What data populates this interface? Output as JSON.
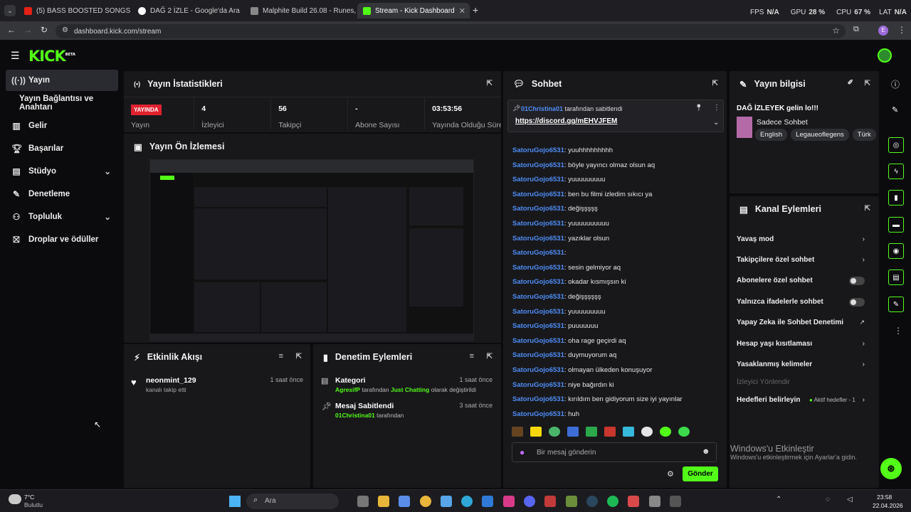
{
  "browser": {
    "tabs": [
      {
        "label": "(5) BASS BOOSTED SONGS 202"
      },
      {
        "label": "DAĞ 2 İZLE - Google'da Ara"
      },
      {
        "label": "Malphite Build 26.08 - Runes, It"
      },
      {
        "label": "Stream - Kick Dashboard"
      }
    ],
    "url": "dashboard.kick.com/stream",
    "perf": {
      "fps_label": "FPS",
      "fps_value": "N/A",
      "gpu_label": "GPU",
      "gpu_value": "28 %",
      "cpu_label": "CPU",
      "cpu_value": "67 %",
      "lat_label": "LAT",
      "lat_value": "N/A"
    },
    "profile_initial": "E"
  },
  "logo": {
    "text": "KICK",
    "beta": "BETA"
  },
  "sidebar": {
    "items": [
      {
        "label": "Yayın",
        "icon": "broadcast-icon"
      },
      {
        "label": "Yayın Bağlantısı ve Anahtarı"
      },
      {
        "label": "Gelir",
        "icon": "chart-icon"
      },
      {
        "label": "Başarılar",
        "icon": "trophy-icon"
      },
      {
        "label": "Stüdyo",
        "icon": "studio-icon"
      },
      {
        "label": "Denetleme",
        "icon": "wrench-icon"
      },
      {
        "label": "Topluluk",
        "icon": "community-icon"
      },
      {
        "label": "Droplar ve ödüller",
        "icon": "gift-icon"
      }
    ]
  },
  "stats_panel": {
    "title": "Yayın İstatistikleri",
    "live_badge": "YAYINDA",
    "cells": [
      {
        "label": "Yayın",
        "value": ""
      },
      {
        "label": "İzleyici",
        "value": "4"
      },
      {
        "label": "Takipçi",
        "value": "56"
      },
      {
        "label": "Abone Sayısı",
        "value": "-"
      },
      {
        "label": "Yayında Olduğu Süre",
        "value": "03:53:56"
      }
    ]
  },
  "preview_panel": {
    "title": "Yayın Ön İzlemesi"
  },
  "activity_panel": {
    "title": "Etkinlik Akışı",
    "items": [
      {
        "user": "neonmint_129",
        "text": "kanalı takip etti",
        "time": "1 saat önce"
      }
    ]
  },
  "moderation_panel": {
    "title": "Denetim Eylemleri",
    "items": [
      {
        "title": "Kategori",
        "user": "AgresifP",
        "mid": "tarafından",
        "highlight": "Just Chatting",
        "tail": "olarak değiştirildi",
        "time": "1 saat önce"
      },
      {
        "title": "Mesaj Sabitlendi",
        "user": "01Christina01",
        "mid": "tarafından",
        "highlight": "",
        "tail": "",
        "time": "3 saat önce"
      }
    ]
  },
  "chat": {
    "title": "Sohbet",
    "pinned": {
      "user": "01Christina01",
      "by": "tarafından sabitlendi",
      "link": "https://discord.gg/mEHVJFEM"
    },
    "messages": [
      {
        "user": "SatoruGojo6531",
        "text": ": yuuhhhhhhhhh"
      },
      {
        "user": "SatoruGojo6531",
        "text": ": böyle yayıncı olmaz olsun aq"
      },
      {
        "user": "SatoruGojo6531",
        "text": ": yuuuuuuuuu"
      },
      {
        "user": "SatoruGojo6531",
        "text": ": ben bu filmi izledim sıkıcı ya"
      },
      {
        "user": "SatoruGojo6531",
        "text": ": değişşşşş"
      },
      {
        "user": "SatoruGojo6531",
        "text": ": yuuuuuuuuuu"
      },
      {
        "user": "SatoruGojo6531",
        "text": ": yazıklar olsun"
      },
      {
        "user": "SatoruGojo6531",
        "text": ":"
      },
      {
        "user": "SatoruGojo6531",
        "text": ": sesin gelmiyor aq"
      },
      {
        "user": "SatoruGojo6531",
        "text": ": okadar kısmışsın ki"
      },
      {
        "user": "SatoruGojo6531",
        "text": ": değişşşşşş"
      },
      {
        "user": "SatoruGojo6531",
        "text": ": yuuuuuuuuu"
      },
      {
        "user": "SatoruGojo6531",
        "text": ": puuuuuuu"
      },
      {
        "user": "SatoruGojo6531",
        "text": ": oha rage geçirdi aq"
      },
      {
        "user": "SatoruGojo6531",
        "text": ": duymuyorum aq"
      },
      {
        "user": "SatoruGojo6531",
        "text": ": olmayan ülkeden konuşuyor"
      },
      {
        "user": "SatoruGojo6531",
        "text": ": niye bağırdın ki"
      },
      {
        "user": "SatoruGojo6531",
        "text": ": kırıldım ben gidiyorum size iyi yayınlar"
      },
      {
        "user": "SatoruGojo6531",
        "text": ": huh"
      }
    ],
    "input_placeholder": "Bir mesaj gönderin",
    "send_label": "Gönder"
  },
  "stream_info": {
    "title": "Yayın bilgisi",
    "stream_title": "DAĞ İZLEYEK gelin lo!!!",
    "category": "Sadece Sohbet",
    "tags": [
      "English",
      "Legaueoflegens",
      "Türk"
    ]
  },
  "channel_actions": {
    "title": "Kanal Eylemleri",
    "items": [
      {
        "label": "Yavaş mod",
        "control": "chevron"
      },
      {
        "label": "Takipçilere özel sohbet",
        "control": "chevron"
      },
      {
        "label": "Abonelere özel sohbet",
        "control": "toggle",
        "value": false
      },
      {
        "label": "Yalnızca ifadelerle sohbet",
        "control": "toggle",
        "value": false
      },
      {
        "label": "Yapay Zeka ile Sohbet Denetimi",
        "control": "external"
      },
      {
        "label": "Hesap yaşı kısıtlaması",
        "control": "chevron"
      },
      {
        "label": "Yasaklanmış kelimeler",
        "control": "chevron"
      },
      {
        "label": "İzleyici Yönlendir",
        "control": "disabled"
      },
      {
        "label": "Hedefleri belirleyin",
        "control": "goal",
        "extra": "Aktif hedefler - 1"
      }
    ]
  },
  "watermark": {
    "line1": "Windows'u Etkinleştir",
    "line2": "Windows'u etkinleştirmek için Ayarlar'a gidin."
  },
  "taskbar": {
    "weather_temp": "7°C",
    "weather_text": "Bulutlu",
    "search": "Ara",
    "time": "23:58",
    "date": "22.04.2026"
  },
  "colors": {
    "accent": "#53fc18",
    "live": "#e0222f",
    "chat_user": "#4f8df5",
    "panel": "#18181b",
    "bg": "#0b0b0d"
  }
}
